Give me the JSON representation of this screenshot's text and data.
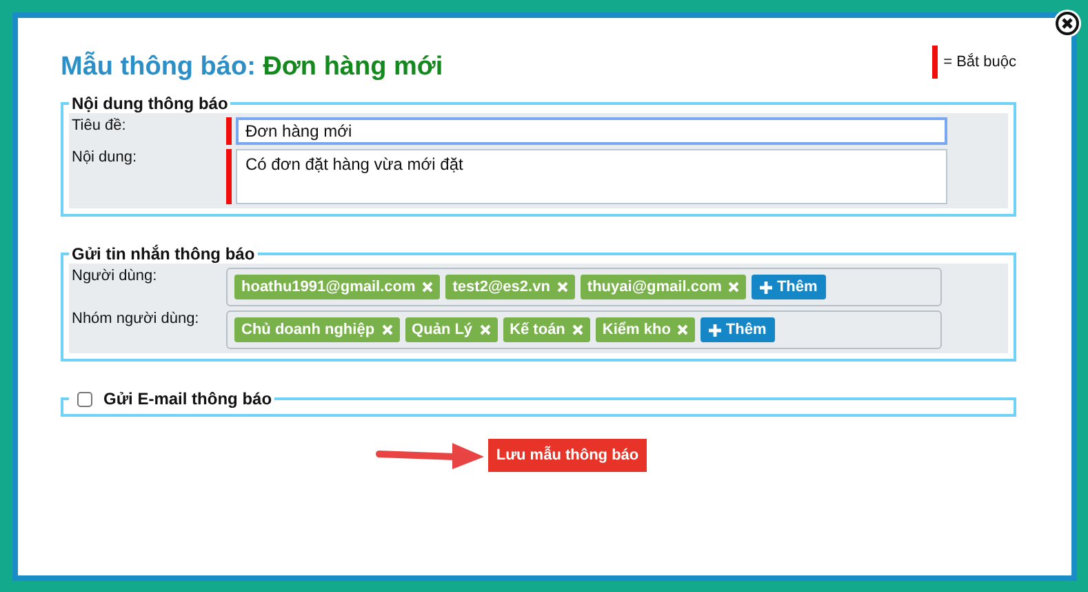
{
  "dialog": {
    "title_prefix": "Mẫu thông báo:",
    "title_name": "Đơn hàng mới",
    "required_legend": "= Bắt buộc"
  },
  "content_section": {
    "legend": "Nội dung thông báo",
    "fields": [
      {
        "label": "Tiêu đề:",
        "value": "Đơn hàng mới",
        "kind": "input",
        "required": true,
        "focused": true
      },
      {
        "label": "Nội dung:",
        "value": "Có đơn đặt hàng vừa mới đặt",
        "kind": "textarea",
        "required": true,
        "focused": false
      }
    ]
  },
  "message_section": {
    "legend": "Gửi tin nhắn thông báo",
    "rows": [
      {
        "label": "Người dùng:",
        "tags": [
          "hoathu1991@gmail.com",
          "test2@es2.vn",
          "thuyai@gmail.com"
        ],
        "add_label": "Thêm"
      },
      {
        "label": "Nhóm người dùng:",
        "tags": [
          "Chủ doanh nghiệp",
          "Quản Lý",
          "Kế toán",
          "Kiểm kho"
        ],
        "add_label": "Thêm"
      }
    ]
  },
  "email_section": {
    "legend": "Gửi E-mail thông báo",
    "checked": false
  },
  "save_button": "Lưu mẫu thông báo"
}
